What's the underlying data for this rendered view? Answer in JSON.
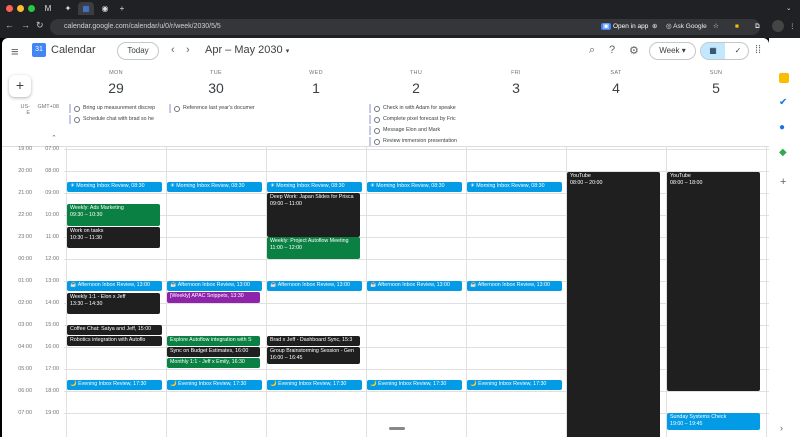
{
  "browser": {
    "url": "calendar.google.com/calendar/u/0/r/week/2030/5/5",
    "open_in_app": "Open in app",
    "ask_google": "Ask Google"
  },
  "header": {
    "app_name": "Calendar",
    "today": "Today",
    "date_range": "Apr – May 2030",
    "view": "Week"
  },
  "timezones": {
    "primary": "US-E",
    "secondary": "GMT+08"
  },
  "days": [
    {
      "name": "MON",
      "num": "29"
    },
    {
      "name": "TUE",
      "num": "30"
    },
    {
      "name": "WED",
      "num": "1"
    },
    {
      "name": "THU",
      "num": "2"
    },
    {
      "name": "FRI",
      "num": "3"
    },
    {
      "name": "SAT",
      "num": "4"
    },
    {
      "name": "SUN",
      "num": "5"
    }
  ],
  "allday": {
    "mon": [
      "Bring up measurement discrep",
      "Schedule chat with brad so he"
    ],
    "tue": [
      "Reference last year's documer"
    ],
    "thu": [
      "Check in with Adam for speake",
      "Complete pixel forecast by Fric",
      "Message Elon and Mark",
      "Review immersion presentation"
    ]
  },
  "hours": [
    {
      "a": "19:00",
      "b": "07:00"
    },
    {
      "a": "20:00",
      "b": "08:00"
    },
    {
      "a": "21:00",
      "b": "09:00"
    },
    {
      "a": "22:00",
      "b": "10:00"
    },
    {
      "a": "23:00",
      "b": "11:00"
    },
    {
      "a": "00:00",
      "b": "12:00"
    },
    {
      "a": "01:00",
      "b": "13:00"
    },
    {
      "a": "02:00",
      "b": "14:00"
    },
    {
      "a": "03:00",
      "b": "15:00"
    },
    {
      "a": "04:00",
      "b": "16:00"
    },
    {
      "a": "05:00",
      "b": "17:00"
    },
    {
      "a": "06:00",
      "b": "18:00"
    },
    {
      "a": "07:00",
      "b": "19:00"
    }
  ],
  "events": {
    "morning": "☀ Morning Inbox Review, 08:30",
    "afternoon": "☕ Afternoon Inbox Review, 13:00",
    "evening": "🌙 Evening Inbox Review, 17:30",
    "ads_title": "Weekly: Ads Marketing",
    "ads_time": "09:30 – 10:30",
    "tasks_title": "Work on tasks",
    "tasks_time": "10:30 – 11:30",
    "elon_title": "Weekly 1:1 - Elon x Jeff",
    "elon_time": "13:30 – 14:30",
    "satya": "Coffee Chat: Satya and Jeff, 15:00",
    "robotics": "Robotics integration with Autoflo",
    "apac": "[Weekly] APAC Snippets, 13:30",
    "explore": "Explore Autoflow integration with S",
    "budget": "Sync on Budget Estimates, 16:00",
    "monthly": "Monthly 1:1 - Jeff x Emily, 16:30",
    "deep_title": "Deep Work: Japan Slides for Prisca",
    "deep_time": "09:00 – 11:00",
    "autoflow_title": "Weekly: Project Autoflow Meeting",
    "autoflow_time": "11:00 – 12:00",
    "dash": "Brad x Jeff - Dashboard Sync, 15:3",
    "group_title": "Group Brainstorming Session - Gen",
    "group_time": "16:00 – 16:45",
    "yt_sat_title": "YouTube",
    "yt_sat_time": "08:00 – 20:00",
    "yt_sun_title": "YouTube",
    "yt_sun_time": "08:00 – 18:00",
    "sunday_title": "Sunday Systems Check",
    "sunday_time": "19:00 – 19:45"
  },
  "colors": {
    "blue": "#039be5",
    "green": "#0b8043",
    "dark": "#1f1f1f",
    "purple": "#8e24aa"
  }
}
